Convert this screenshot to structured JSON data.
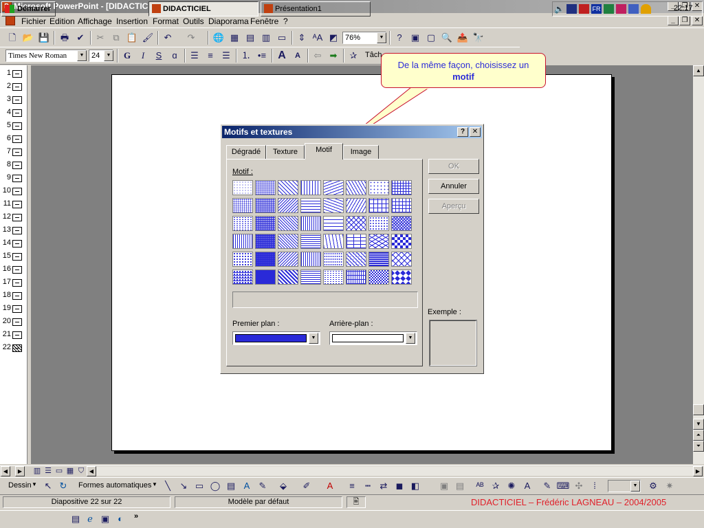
{
  "window": {
    "title": "Microsoft PowerPoint - [DIDACTICIEL]"
  },
  "menu": [
    {
      "label": "Fichier"
    },
    {
      "label": "Edition"
    },
    {
      "label": "Affichage"
    },
    {
      "label": "Insertion"
    },
    {
      "label": "Format"
    },
    {
      "label": "Outils"
    },
    {
      "label": "Diaporama"
    },
    {
      "label": "Fenêtre"
    },
    {
      "label": "?"
    }
  ],
  "toolbar": {
    "zoom": "76%"
  },
  "formatting": {
    "font": "Times New Roman",
    "size": "24",
    "bold": "G",
    "italic": "I",
    "shadow": "S",
    "outline": "ɑ",
    "task": "Tâch"
  },
  "slides": {
    "count": 22
  },
  "callout": {
    "line1": "De la même façon, choisissez un",
    "line2": "motif"
  },
  "dialog": {
    "title": "Motifs et textures",
    "help": "?",
    "close": "✕",
    "tabs": [
      {
        "label": "Dégradé"
      },
      {
        "label": "Texture"
      },
      {
        "label": "Motif"
      },
      {
        "label": "Image"
      }
    ],
    "motif_label": "Motif :",
    "foreground_label": "Premier plan :",
    "background_label": "Arrière-plan :",
    "foreground_color": "#2a2ad8",
    "background_color": "#ffffff",
    "ok": "OK",
    "cancel": "Annuler",
    "preview": "Aperçu",
    "example_label": "Exemple :"
  },
  "drawing": {
    "draw": "Dessin",
    "autoshapes": "Formes automatiques"
  },
  "status": {
    "slide": "Diapositive 22 sur 22",
    "template": "Modèle par défaut",
    "credit": "DIDACTICIEL – Frédéric LAGNEAU – 2004/2005"
  },
  "taskbar": {
    "start": "Démarrer",
    "task1": "DIDACTICIEL",
    "task2": "Présentation1",
    "clock": "22:17"
  }
}
